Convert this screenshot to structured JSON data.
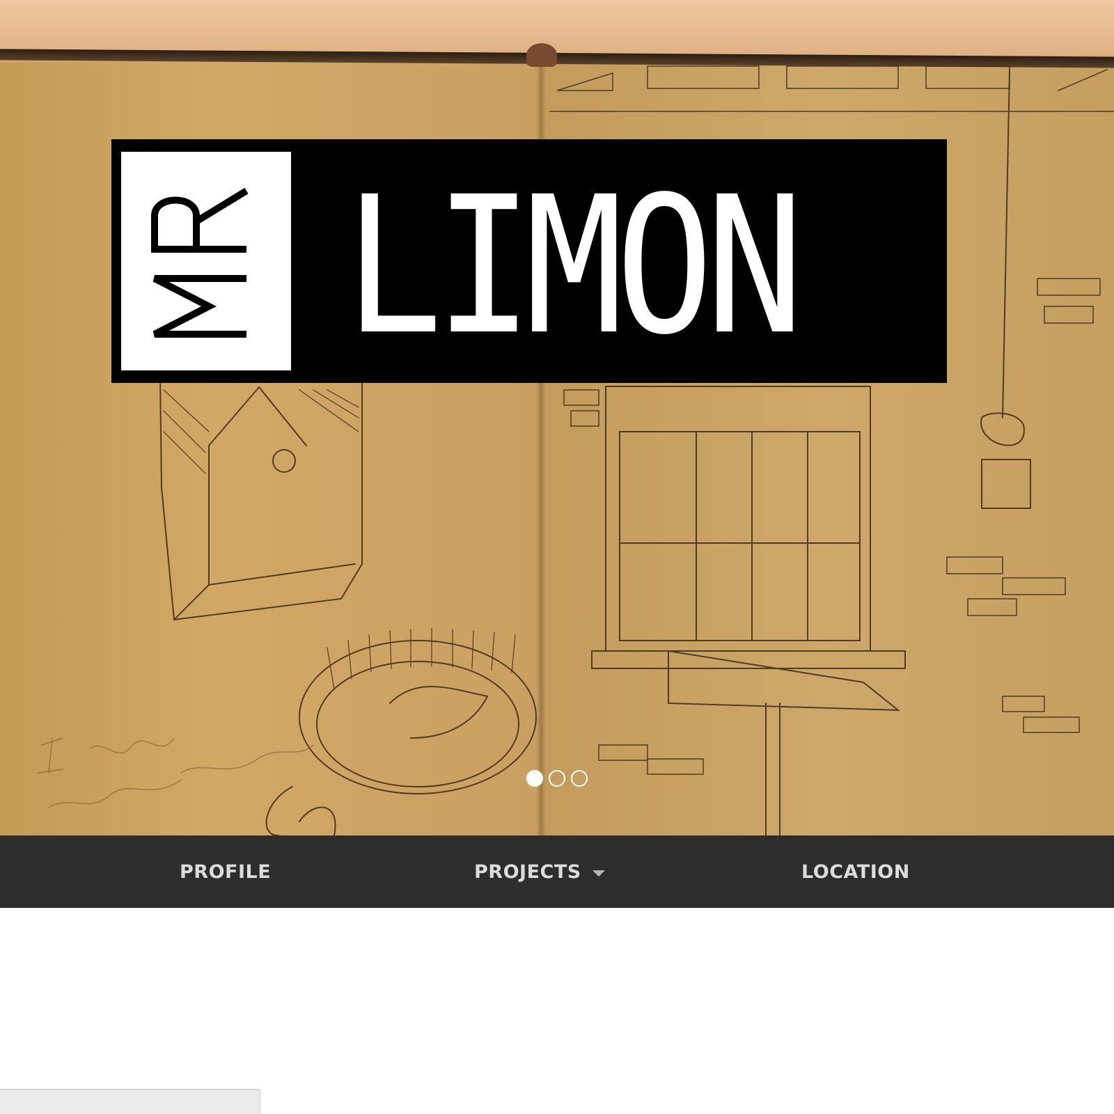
{
  "hero": {
    "logo": {
      "prefix": "MR",
      "name": "LIMON"
    },
    "slides_total": 3,
    "active_slide": 1
  },
  "nav": {
    "items": [
      {
        "label": "PROFILE"
      },
      {
        "label": "PROJECTS"
      },
      {
        "label": "LOCATION"
      }
    ]
  },
  "colors": {
    "nav_bg": "#2d2d2d",
    "nav_text": "#dcdcdc",
    "logo_bg": "#000000",
    "logo_text": "#ffffff"
  },
  "icons": {
    "projects_dropdown": "chevron-down-icon"
  }
}
